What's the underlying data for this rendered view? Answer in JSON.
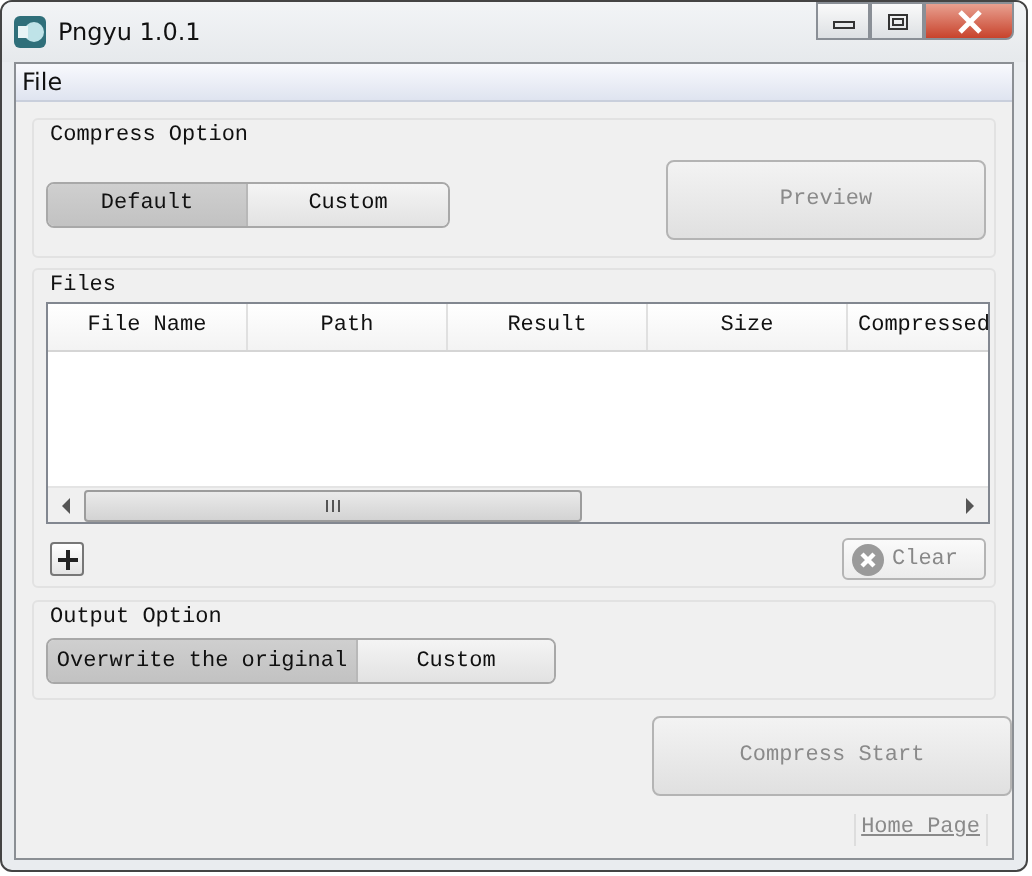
{
  "window": {
    "title": "Pngyu 1.0.1"
  },
  "menu": [
    "File"
  ],
  "compress_option": {
    "title": "Compress Option",
    "options": [
      {
        "label": "Default",
        "selected": true
      },
      {
        "label": "Custom",
        "selected": false
      }
    ],
    "preview_button": {
      "label": "Preview",
      "disabled": true
    }
  },
  "files": {
    "title": "Files",
    "columns": [
      "File Name",
      "Path",
      "Result",
      "Size",
      "Compressed"
    ],
    "clear_button": {
      "label": "Clear",
      "disabled": true
    }
  },
  "output_option": {
    "title": "Output Option",
    "options": [
      {
        "label": "Overwrite the original",
        "selected": true
      },
      {
        "label": "Custom",
        "selected": false
      }
    ]
  },
  "compress_start_button": {
    "label": "Compress Start",
    "disabled": true
  },
  "home_page_link": "Home Page"
}
